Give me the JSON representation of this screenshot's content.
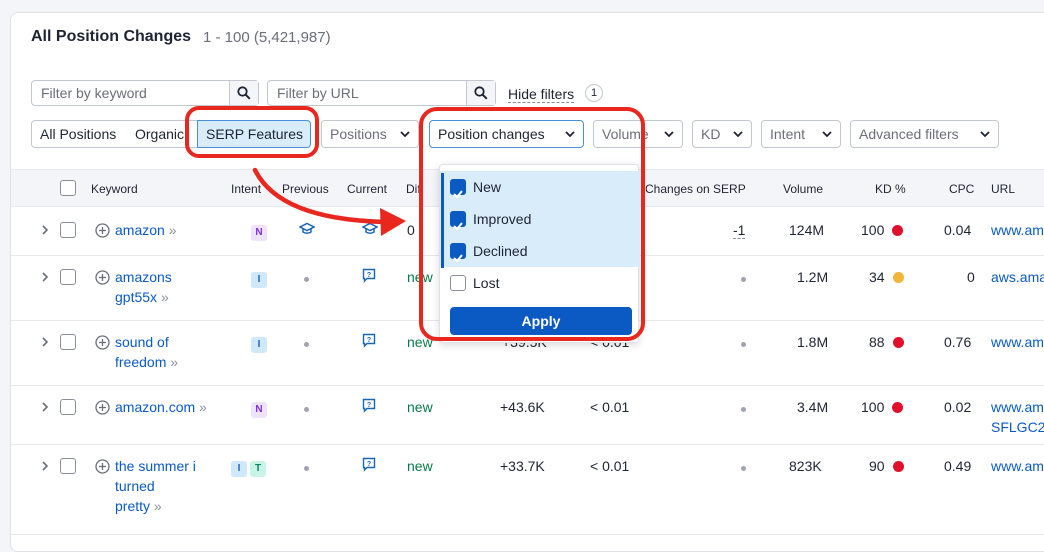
{
  "header": {
    "title": "All Position Changes",
    "count": "1 - 100 (5,421,987)"
  },
  "filters": {
    "keyword_placeholder": "Filter by keyword",
    "url_placeholder": "Filter by URL",
    "hide_filters": "Hide filters",
    "hide_filters_count": "1"
  },
  "segments": [
    "All Positions",
    "Organic",
    "SERP Features"
  ],
  "dropdowns": [
    "Positions",
    "Position changes",
    "Volume",
    "KD",
    "Intent",
    "Advanced filters"
  ],
  "columns": {
    "keyword": "Keyword",
    "intent": "Intent",
    "previous": "Previous",
    "current": "Current",
    "diff": "Dif.",
    "changes": "Changes on SERP",
    "volume": "Volume",
    "kd": "KD %",
    "cpc": "CPC",
    "url": "URL"
  },
  "rows": [
    {
      "kw1": "amazon",
      "kw2": "",
      "kw3": "",
      "intents": [
        "N"
      ],
      "diff": "0",
      "traffic": "",
      "share": "",
      "changes": "-1",
      "volume": "124M",
      "kd": "100",
      "kd_color": "#e0102d",
      "cpc": "0.04",
      "url1": "www.am",
      "url2": ""
    },
    {
      "kw1": "amazons",
      "kw2": "gpt55x",
      "kw3": "",
      "intents": [
        "I"
      ],
      "diff": "new",
      "traffic": "",
      "share": "",
      "changes": "",
      "volume": "1.2M",
      "kd": "34",
      "kd_color": "#f2b53a",
      "cpc": "0",
      "url1": "aws.ama",
      "url2": ""
    },
    {
      "kw1": "sound of",
      "kw2": "freedom",
      "kw3": "",
      "intents": [
        "I"
      ],
      "diff": "new",
      "traffic": "+39.5K",
      "share": "< 0.01",
      "changes": "",
      "volume": "1.8M",
      "kd": "88",
      "kd_color": "#e0102d",
      "cpc": "0.76",
      "url1": "www.am",
      "url2": ""
    },
    {
      "kw1": "amazon.com",
      "kw2": "",
      "kw3": "",
      "intents": [
        "N"
      ],
      "diff": "new",
      "traffic": "+43.6K",
      "share": "< 0.01",
      "changes": "",
      "volume": "3.4M",
      "kd": "100",
      "kd_color": "#e0102d",
      "cpc": "0.02",
      "url1": "www.am",
      "url2": "SFLGC2"
    },
    {
      "kw1": "the summer i",
      "kw2": "turned",
      "kw3": "pretty",
      "intents": [
        "I",
        "T"
      ],
      "diff": "new",
      "traffic": "+33.7K",
      "share": "< 0.01",
      "changes": "",
      "volume": "823K",
      "kd": "90",
      "kd_color": "#e0102d",
      "cpc": "0.49",
      "url1": "www.am",
      "url2": ""
    }
  ],
  "popup": {
    "options": [
      {
        "label": "New",
        "checked": true
      },
      {
        "label": "Improved",
        "checked": true
      },
      {
        "label": "Declined",
        "checked": true
      },
      {
        "label": "Lost",
        "checked": false
      }
    ],
    "apply": "Apply"
  },
  "colors": {
    "accent": "#0b5ac4",
    "annotation": "#e8271f"
  }
}
